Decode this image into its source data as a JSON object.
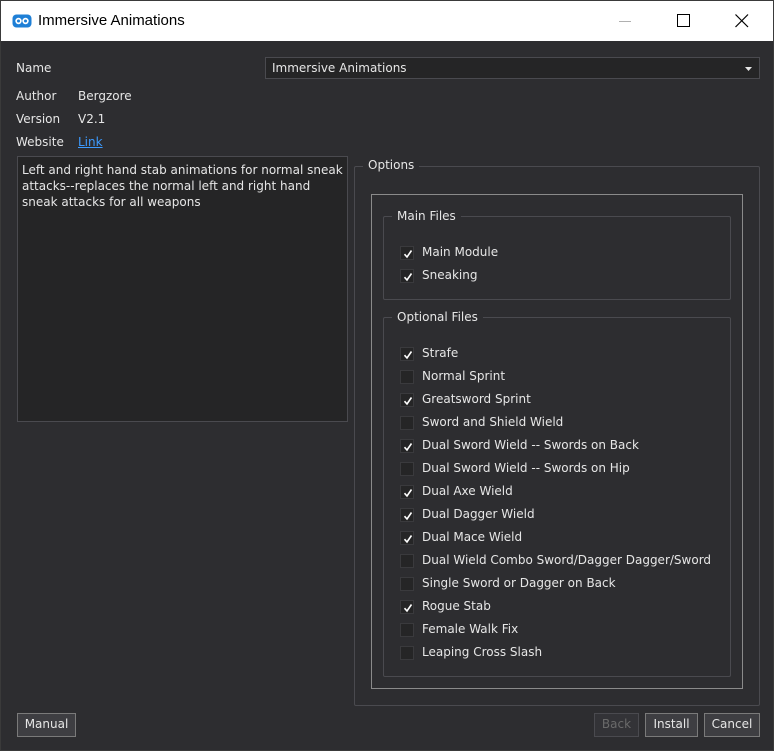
{
  "window": {
    "title": "Immersive Animations",
    "app_icon": "mo2-icon"
  },
  "titlebar_buttons": {
    "minimize": "minimize-icon",
    "maximize": "maximize-icon",
    "close": "close-icon"
  },
  "info": {
    "name_label": "Name",
    "name_value": "Immersive Animations",
    "author_label": "Author",
    "author_value": "Bergzore",
    "version_label": "Version",
    "version_value": "V2.1",
    "website_label": "Website",
    "website_link": "Link"
  },
  "description": "Left and right hand stab animations for normal sneak attacks--replaces the normal left and right hand sneak attacks for all weapons",
  "options": {
    "legend": "Options",
    "main_files": {
      "legend": "Main Files",
      "items": [
        {
          "label": "Main Module",
          "checked": true
        },
        {
          "label": "Sneaking",
          "checked": true
        }
      ]
    },
    "optional_files": {
      "legend": "Optional Files",
      "items": [
        {
          "label": "Strafe",
          "checked": true
        },
        {
          "label": "Normal Sprint",
          "checked": false
        },
        {
          "label": "Greatsword Sprint",
          "checked": true
        },
        {
          "label": "Sword and Shield Wield",
          "checked": false
        },
        {
          "label": "Dual Sword Wield -- Swords on Back",
          "checked": true
        },
        {
          "label": "Dual Sword Wield -- Swords on Hip",
          "checked": false
        },
        {
          "label": "Dual Axe Wield",
          "checked": true
        },
        {
          "label": "Dual Dagger Wield",
          "checked": true
        },
        {
          "label": "Dual Mace Wield",
          "checked": true
        },
        {
          "label": "Dual Wield Combo Sword/Dagger Dagger/Sword",
          "checked": false
        },
        {
          "label": "Single Sword or Dagger on Back",
          "checked": false
        },
        {
          "label": "Rogue Stab",
          "checked": true
        },
        {
          "label": "Female Walk Fix",
          "checked": false
        },
        {
          "label": "Leaping Cross Slash",
          "checked": false
        }
      ]
    }
  },
  "buttons": {
    "manual": "Manual",
    "back": "Back",
    "install": "Install",
    "cancel": "Cancel"
  },
  "colors": {
    "background": "#2d2d30",
    "field": "#252526",
    "link": "#3d9bff",
    "titlebar": "#ffffff"
  }
}
